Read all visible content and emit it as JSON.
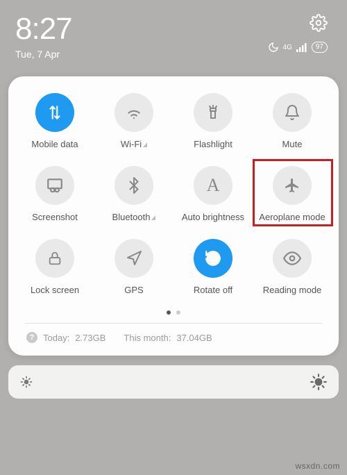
{
  "status": {
    "time": "8:27",
    "date": "Tue, 7 Apr",
    "network_label": "4G",
    "battery": "97"
  },
  "tiles": {
    "mobile_data": "Mobile data",
    "wifi": "Wi-Fi",
    "flashlight": "Flashlight",
    "mute": "Mute",
    "screenshot": "Screenshot",
    "bluetooth": "Bluetooth",
    "auto_brightness": "Auto brightness",
    "aeroplane": "Aeroplane mode",
    "lock_screen": "Lock screen",
    "gps": "GPS",
    "rotate_off": "Rotate off",
    "reading_mode": "Reading mode"
  },
  "usage": {
    "today_label": "Today:",
    "today_value": "2.73GB",
    "month_label": "This month:",
    "month_value": "37.04GB"
  },
  "watermark": "wsxdn.com"
}
